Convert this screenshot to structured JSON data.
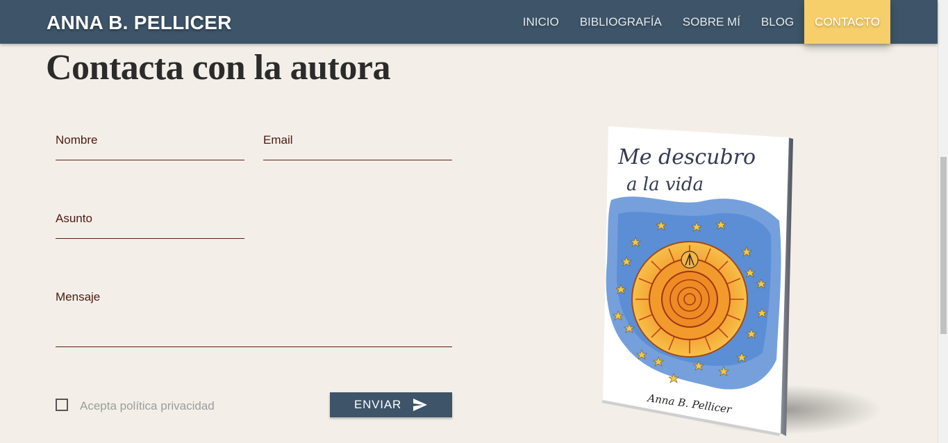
{
  "header": {
    "brand": "ANNA B. PELLICER",
    "nav": [
      {
        "label": "INICIO"
      },
      {
        "label": "BIBLIOGRAFÍA"
      },
      {
        "label": "SOBRE MÍ"
      },
      {
        "label": "BLOG"
      },
      {
        "label": "CONTACTO",
        "active": true
      }
    ],
    "bar_color": "#3d5469",
    "active_color": "#f6cf6a"
  },
  "main": {
    "title": "Contacta con la autora"
  },
  "form": {
    "name_label": "Nombre",
    "email_label": "Email",
    "subject_label": "Asunto",
    "message_label": "Mensaje",
    "privacy_label": "Acepta política privacidad",
    "privacy_checked": false,
    "submit_label": "ENVIAR",
    "submit_icon": "send-icon"
  },
  "book": {
    "title_line1": "Me descubro",
    "title_line2": "a la vida",
    "author_signature": "Anna B. Pellicer"
  }
}
